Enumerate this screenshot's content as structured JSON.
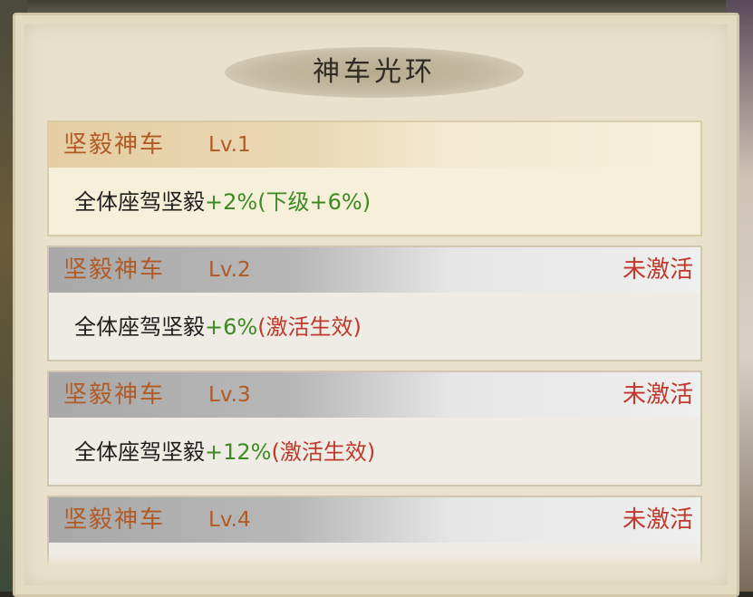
{
  "panel": {
    "title": "神车光环"
  },
  "cards": [
    {
      "name": "坚毅神车",
      "level": "Lv.1",
      "status": "",
      "desc_label": "全体座驾坚毅",
      "desc_value": "+2%",
      "desc_note": "(下级+6%)",
      "active": true
    },
    {
      "name": "坚毅神车",
      "level": "Lv.2",
      "status": "未激活",
      "desc_label": "全体座驾坚毅",
      "desc_value": "+6%",
      "desc_note": "(激活生效)",
      "active": false
    },
    {
      "name": "坚毅神车",
      "level": "Lv.3",
      "status": "未激活",
      "desc_label": "全体座驾坚毅",
      "desc_value": "+12%",
      "desc_note": "(激活生效)",
      "active": false
    },
    {
      "name": "坚毅神车",
      "level": "Lv.4",
      "status": "未激活",
      "desc_label": "",
      "desc_value": "",
      "desc_note": "",
      "active": false
    }
  ],
  "colors": {
    "name": "#b25a25",
    "status_inactive": "#c0392b",
    "value_green": "#3d8a22"
  }
}
